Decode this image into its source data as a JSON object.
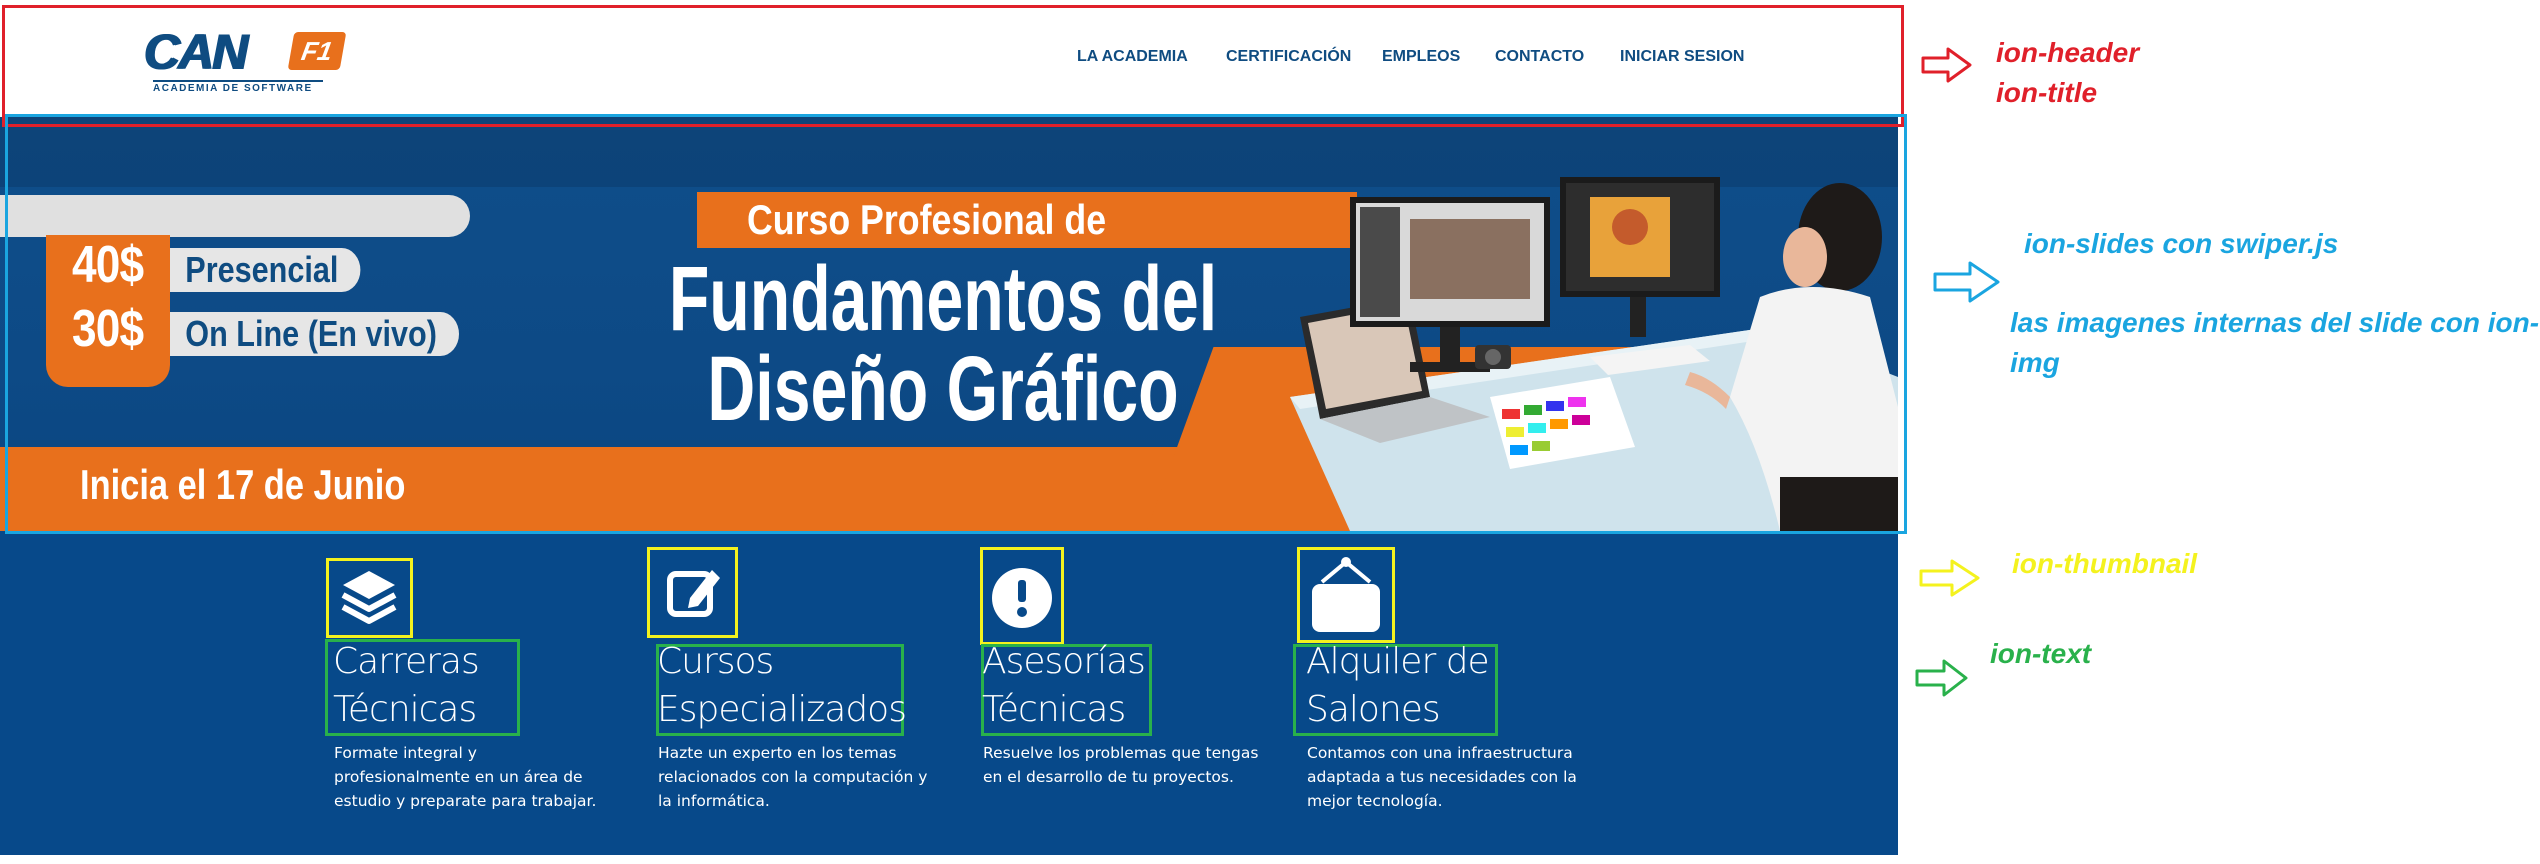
{
  "header": {
    "logo_text": "CAN",
    "logo_badge": "F1",
    "logo_subtitle": "ACADEMIA DE SOFTWARE",
    "nav": [
      "LA ACADEMIA",
      "CERTIFICACIÓN",
      "EMPLEOS",
      "CONTACTO",
      "INICIAR SESION"
    ]
  },
  "slide": {
    "prices": [
      {
        "price": "40$",
        "mode": "Presencial"
      },
      {
        "price": "30$",
        "mode": "On Line (En vivo)"
      }
    ],
    "course_tag": "Curso Profesional de",
    "title_line1": "Fundamentos del",
    "title_line2": "Diseño Gráfico",
    "start_date": "Inicia el 17 de Junio"
  },
  "features": [
    {
      "icon": "layers-icon",
      "title_line1": "Carreras",
      "title_line2": "Técnicas",
      "desc": "Formate integral y profesionalmente en un área de estudio y preparate para trabajar."
    },
    {
      "icon": "edit-icon",
      "title_line1": "Cursos",
      "title_line2": "Especializados",
      "desc": "Hazte un experto en los temas relacionados con la computación y la informática."
    },
    {
      "icon": "alert-icon",
      "title_line1": "Asesorías",
      "title_line2": "Técnicas",
      "desc": "Resuelve los problemas que tengas en el desarrollo de tu proyectos."
    },
    {
      "icon": "sign-icon",
      "title_line1": "Alquiler de",
      "title_line2": "Salones",
      "desc": "Contamos con una infraestructura adaptada a tus necesidades con la mejor tecnología."
    }
  ],
  "annotations": {
    "header_line1": "ion-header",
    "header_line2": "ion-title",
    "slides_line1": "ion-slides con swiper.js",
    "slides_line2": "las imagenes internas del slide con ion-",
    "slides_line3": "img",
    "thumbnail": "ion-thumbnail",
    "text": "ion-text"
  },
  "colors": {
    "brand_blue": "#0f4c81",
    "accent_orange": "#e8701c",
    "section_blue": "#07498a",
    "annotation_red": "#e0202a",
    "annotation_blue": "#1aa5e0",
    "annotation_yellow": "#f4f21e",
    "annotation_green": "#29b14b"
  }
}
